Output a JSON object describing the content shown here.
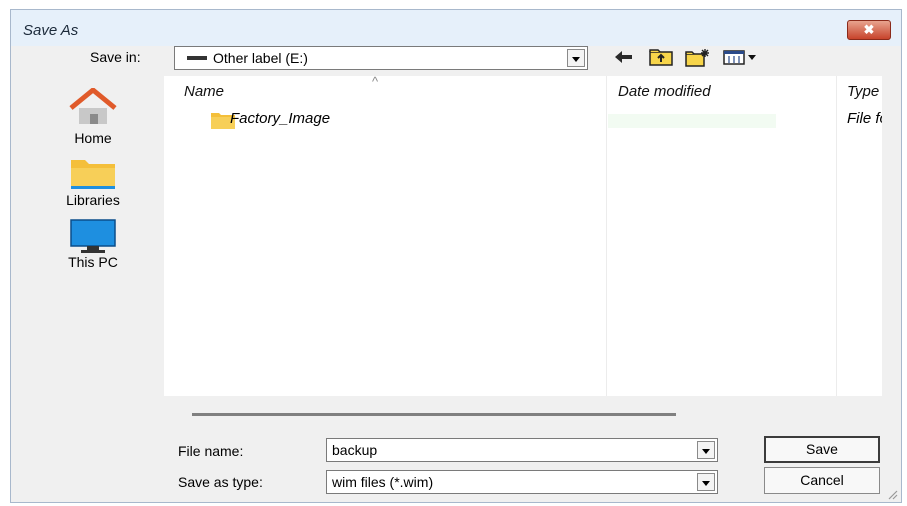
{
  "window": {
    "title": "Save As",
    "close_label": "✖"
  },
  "save_in": {
    "label": "Save in:",
    "value": "Other label (E:)"
  },
  "toolbar": {
    "icons": [
      "back-arrow-icon",
      "up-folder-icon",
      "new-folder-icon",
      "view-menu-icon"
    ]
  },
  "places": [
    {
      "label": "Home",
      "icon": "home-icon"
    },
    {
      "label": "Libraries",
      "icon": "libraries-folder-icon"
    },
    {
      "label": "This PC",
      "icon": "monitor-icon"
    }
  ],
  "file_list": {
    "columns": {
      "name": "Name",
      "date": "Date modified",
      "type": "Type"
    },
    "sort_indicator": "^",
    "rows": [
      {
        "name": "Factory_Image",
        "type": "File fo"
      }
    ]
  },
  "file_name": {
    "label": "File name:",
    "value": "backup"
  },
  "save_type": {
    "label": "Save as type:",
    "value": "wim files (*.wim)"
  },
  "buttons": {
    "save": "Save",
    "cancel": "Cancel"
  },
  "colors": {
    "folder": "#f4bf3a",
    "home_roof": "#e05a2a",
    "accent": "#1e8fe0"
  }
}
